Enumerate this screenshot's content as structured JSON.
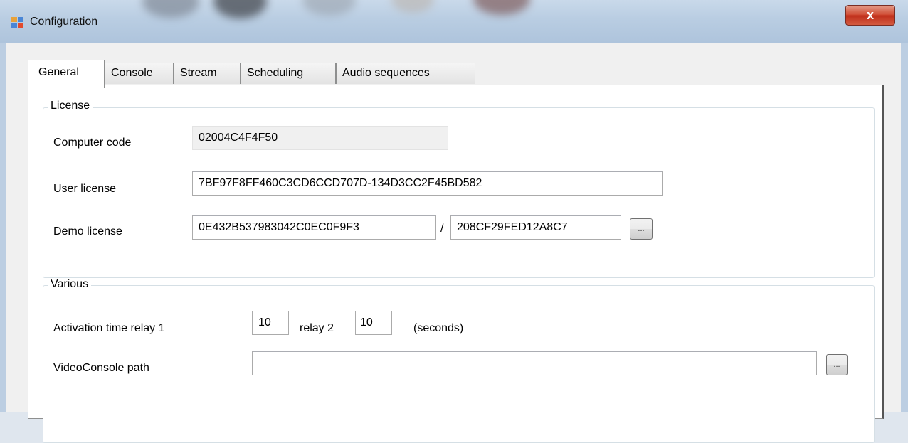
{
  "window": {
    "title": "Configuration",
    "close_glyph": "x"
  },
  "tabs": [
    {
      "label": "General",
      "active": true
    },
    {
      "label": "Console",
      "active": false
    },
    {
      "label": "Stream",
      "active": false
    },
    {
      "label": "Scheduling",
      "active": false
    },
    {
      "label": "Audio sequences",
      "active": false
    }
  ],
  "license": {
    "group_title": "License",
    "computer_code_label": "Computer code",
    "computer_code_value": "02004C4F4F50",
    "user_license_label": "User license",
    "user_license_value": "7BF97F8FF460C3CD6CCD707D-134D3CC2F45BD582",
    "demo_license_label": "Demo license",
    "demo_license_value_1": "0E432B537983042C0EC0F9F3",
    "demo_separator": "/",
    "demo_license_value_2": "208CF29FED12A8C7",
    "browse_label": "..."
  },
  "various": {
    "group_title": "Various",
    "activation_label": "Activation time relay 1",
    "relay1_value": "10",
    "relay2_label": "relay 2",
    "relay2_value": "10",
    "seconds_label": "(seconds)",
    "videoconsole_label": "VideoConsole path",
    "videoconsole_value": "",
    "browse_label": "..."
  },
  "icons": {
    "app": "app-window-icon",
    "close": "close-icon"
  }
}
